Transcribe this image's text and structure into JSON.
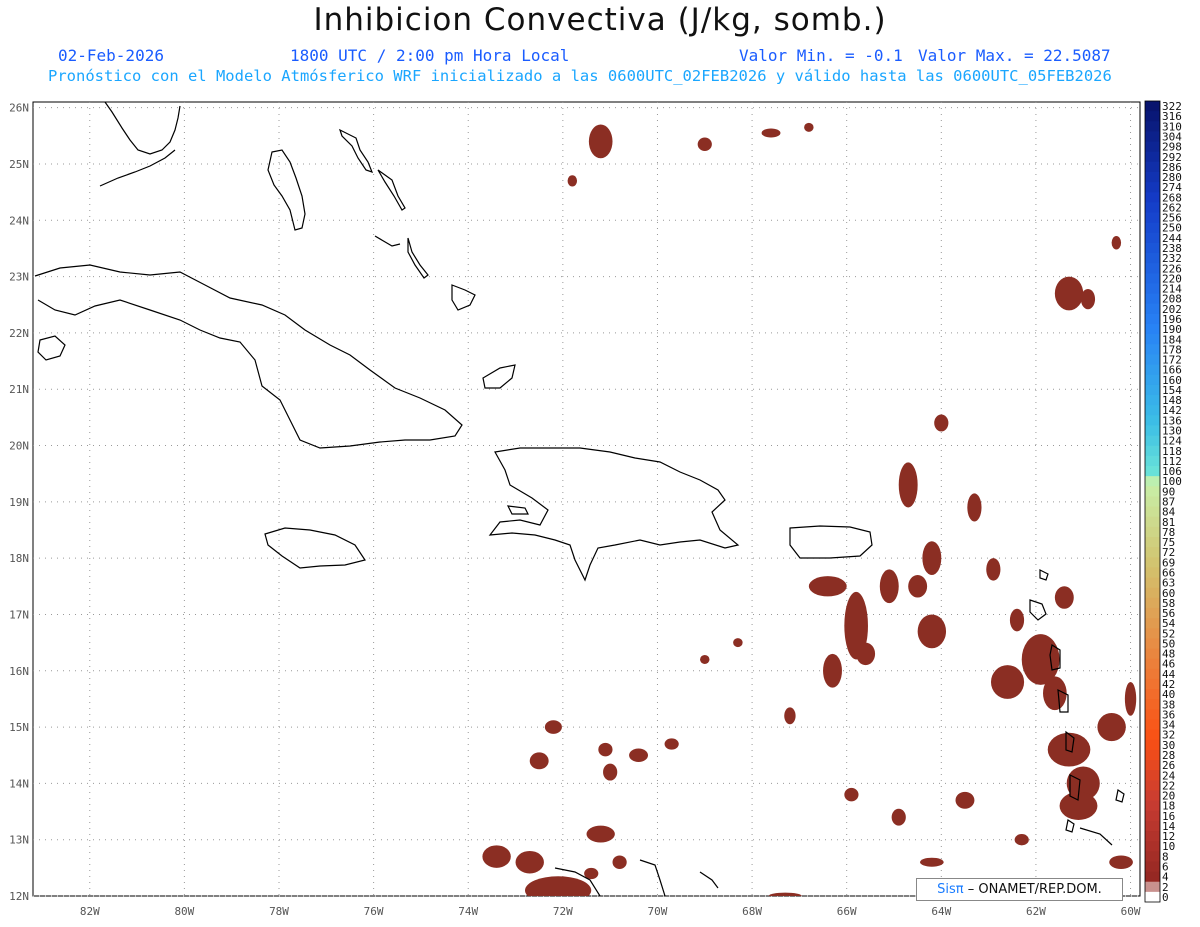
{
  "header": {
    "title": "Inhibicion Convectiva (J/kg, somb.)",
    "date": "02-Feb-2026",
    "time": "1800 UTC / 2:00 pm Hora Local",
    "min_label": "Valor Min. = -0.1",
    "max_label": "Valor Max. = 22.5087",
    "model_info": "Pronóstico con el Modelo Atmósferico WRF inicializado a las 0600UTC_02FEB2026 y válido hasta las  0600UTC_05FEB2026"
  },
  "map": {
    "lon_labels": [
      "82W",
      "80W",
      "78W",
      "76W",
      "74W",
      "72W",
      "70W",
      "68W",
      "66W",
      "64W",
      "62W",
      "60W"
    ],
    "lat_labels": [
      "26N",
      "25N",
      "24N",
      "23N",
      "22N",
      "21N",
      "20N",
      "19N",
      "18N",
      "17N",
      "16N",
      "15N",
      "14N",
      "13N",
      "12N"
    ],
    "lon_values": [
      -82,
      -80,
      -78,
      -76,
      -74,
      -72,
      -70,
      -68,
      -66,
      -64,
      -62,
      -60
    ],
    "lat_values": [
      26,
      25,
      24,
      23,
      22,
      21,
      20,
      19,
      18,
      17,
      16,
      15,
      14,
      13,
      12
    ],
    "lon_range": [
      -83.2,
      -59.8
    ],
    "lat_range": [
      12,
      26.1
    ],
    "shade_color": "#8b2e23",
    "grid": "dotted",
    "cin_areas": [
      {
        "lon": -71.2,
        "lat": 25.4,
        "rlon": 0.25,
        "rlat": 0.3
      },
      {
        "lon": -69.0,
        "lat": 25.35,
        "rlon": 0.15,
        "rlat": 0.12
      },
      {
        "lon": -67.6,
        "lat": 25.55,
        "rlon": 0.2,
        "rlat": 0.08
      },
      {
        "lon": -66.8,
        "lat": 25.65,
        "rlon": 0.1,
        "rlat": 0.08
      },
      {
        "lon": -71.8,
        "lat": 24.7,
        "rlon": 0.1,
        "rlat": 0.1
      },
      {
        "lon": -61.3,
        "lat": 22.7,
        "rlon": 0.3,
        "rlat": 0.3
      },
      {
        "lon": -60.9,
        "lat": 22.6,
        "rlon": 0.15,
        "rlat": 0.18
      },
      {
        "lon": -60.3,
        "lat": 23.6,
        "rlon": 0.1,
        "rlat": 0.12
      },
      {
        "lon": -64.0,
        "lat": 20.4,
        "rlon": 0.15,
        "rlat": 0.15
      },
      {
        "lon": -64.7,
        "lat": 19.3,
        "rlon": 0.2,
        "rlat": 0.4
      },
      {
        "lon": -63.3,
        "lat": 18.9,
        "rlon": 0.15,
        "rlat": 0.25
      },
      {
        "lon": -64.2,
        "lat": 18.0,
        "rlon": 0.2,
        "rlat": 0.3
      },
      {
        "lon": -65.8,
        "lat": 16.8,
        "rlon": 0.25,
        "rlat": 0.6
      },
      {
        "lon": -66.4,
        "lat": 17.5,
        "rlon": 0.4,
        "rlat": 0.18
      },
      {
        "lon": -65.1,
        "lat": 17.5,
        "rlon": 0.2,
        "rlat": 0.3
      },
      {
        "lon": -65.6,
        "lat": 16.3,
        "rlon": 0.2,
        "rlat": 0.2
      },
      {
        "lon": -66.3,
        "lat": 16.0,
        "rlon": 0.2,
        "rlat": 0.3
      },
      {
        "lon": -64.2,
        "lat": 16.7,
        "rlon": 0.3,
        "rlat": 0.3
      },
      {
        "lon": -64.5,
        "lat": 17.5,
        "rlon": 0.2,
        "rlat": 0.2
      },
      {
        "lon": -62.9,
        "lat": 17.8,
        "rlon": 0.15,
        "rlat": 0.2
      },
      {
        "lon": -62.4,
        "lat": 16.9,
        "rlon": 0.15,
        "rlat": 0.2
      },
      {
        "lon": -61.4,
        "lat": 17.3,
        "rlon": 0.2,
        "rlat": 0.2
      },
      {
        "lon": -61.9,
        "lat": 16.2,
        "rlon": 0.4,
        "rlat": 0.45
      },
      {
        "lon": -62.6,
        "lat": 15.8,
        "rlon": 0.35,
        "rlat": 0.3
      },
      {
        "lon": -61.6,
        "lat": 15.6,
        "rlon": 0.25,
        "rlat": 0.3
      },
      {
        "lon": -61.3,
        "lat": 14.6,
        "rlon": 0.45,
        "rlat": 0.3
      },
      {
        "lon": -61.0,
        "lat": 14.0,
        "rlon": 0.35,
        "rlat": 0.3
      },
      {
        "lon": -61.1,
        "lat": 13.6,
        "rlon": 0.4,
        "rlat": 0.25
      },
      {
        "lon": -60.4,
        "lat": 15.0,
        "rlon": 0.3,
        "rlat": 0.25
      },
      {
        "lon": -60.0,
        "lat": 15.5,
        "rlon": 0.12,
        "rlat": 0.3
      },
      {
        "lon": -62.3,
        "lat": 13.0,
        "rlon": 0.15,
        "rlat": 0.1
      },
      {
        "lon": -63.5,
        "lat": 13.7,
        "rlon": 0.2,
        "rlat": 0.15
      },
      {
        "lon": -64.9,
        "lat": 13.4,
        "rlon": 0.15,
        "rlat": 0.15
      },
      {
        "lon": -65.9,
        "lat": 13.8,
        "rlon": 0.15,
        "rlat": 0.12
      },
      {
        "lon": -60.2,
        "lat": 12.6,
        "rlon": 0.25,
        "rlat": 0.12
      },
      {
        "lon": -64.2,
        "lat": 12.6,
        "rlon": 0.25,
        "rlat": 0.08
      },
      {
        "lon": -62.3,
        "lat": 12.0,
        "rlon": 0.3,
        "rlat": 0.06
      },
      {
        "lon": -67.3,
        "lat": 12.0,
        "rlon": 0.35,
        "rlat": 0.06
      },
      {
        "lon": -72.2,
        "lat": 15.0,
        "rlon": 0.18,
        "rlat": 0.12
      },
      {
        "lon": -72.5,
        "lat": 14.4,
        "rlon": 0.2,
        "rlat": 0.15
      },
      {
        "lon": -71.1,
        "lat": 14.6,
        "rlon": 0.15,
        "rlat": 0.12
      },
      {
        "lon": -70.4,
        "lat": 14.5,
        "rlon": 0.2,
        "rlat": 0.12
      },
      {
        "lon": -69.7,
        "lat": 14.7,
        "rlon": 0.15,
        "rlat": 0.1
      },
      {
        "lon": -67.2,
        "lat": 15.2,
        "rlon": 0.12,
        "rlat": 0.15
      },
      {
        "lon": -71.0,
        "lat": 14.2,
        "rlon": 0.15,
        "rlat": 0.15
      },
      {
        "lon": -73.4,
        "lat": 12.7,
        "rlon": 0.3,
        "rlat": 0.2
      },
      {
        "lon": -71.2,
        "lat": 13.1,
        "rlon": 0.3,
        "rlat": 0.15
      },
      {
        "lon": -70.8,
        "lat": 12.6,
        "rlon": 0.15,
        "rlat": 0.12
      },
      {
        "lon": -71.4,
        "lat": 12.4,
        "rlon": 0.15,
        "rlat": 0.1
      },
      {
        "lon": -72.1,
        "lat": 12.1,
        "rlon": 0.7,
        "rlat": 0.25
      },
      {
        "lon": -72.7,
        "lat": 12.6,
        "rlon": 0.3,
        "rlat": 0.2
      },
      {
        "lon": -68.3,
        "lat": 16.5,
        "rlon": 0.1,
        "rlat": 0.08
      },
      {
        "lon": -69.0,
        "lat": 16.2,
        "rlon": 0.1,
        "rlat": 0.08
      }
    ]
  },
  "colorbar": {
    "labels": [
      "322",
      "316",
      "310",
      "304",
      "298",
      "292",
      "286",
      "280",
      "274",
      "268",
      "262",
      "256",
      "250",
      "244",
      "238",
      "232",
      "226",
      "220",
      "214",
      "208",
      "202",
      "196",
      "190",
      "184",
      "178",
      "172",
      "166",
      "160",
      "154",
      "148",
      "142",
      "136",
      "130",
      "124",
      "118",
      "112",
      "106",
      "100",
      "90",
      "87",
      "84",
      "81",
      "78",
      "75",
      "72",
      "69",
      "66",
      "63",
      "60",
      "58",
      "56",
      "54",
      "52",
      "50",
      "48",
      "46",
      "44",
      "42",
      "40",
      "38",
      "36",
      "34",
      "32",
      "30",
      "28",
      "26",
      "24",
      "22",
      "20",
      "18",
      "16",
      "14",
      "12",
      "10",
      "8",
      "6",
      "4",
      "2",
      "0"
    ]
  },
  "credit": {
    "logo": "Sisπ",
    "text": "– ONAMET/REP.DOM."
  }
}
